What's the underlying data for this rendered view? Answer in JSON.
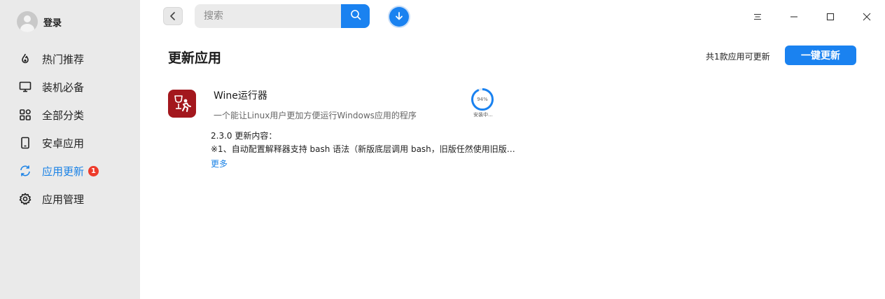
{
  "sidebar": {
    "login_label": "登录",
    "items": [
      {
        "label": "热门推荐",
        "icon": "flame-icon"
      },
      {
        "label": "装机必备",
        "icon": "monitor-icon"
      },
      {
        "label": "全部分类",
        "icon": "grid-icon"
      },
      {
        "label": "安卓应用",
        "icon": "phone-icon"
      },
      {
        "label": "应用更新",
        "icon": "refresh-icon",
        "active": true,
        "badge": "1"
      },
      {
        "label": "应用管理",
        "icon": "gear-icon"
      }
    ]
  },
  "search": {
    "placeholder": "搜索"
  },
  "main": {
    "title": "更新应用",
    "summary": "共1款应用可更新",
    "update_all_label": "一键更新",
    "apps": [
      {
        "name": "Wine运行器",
        "description": "一个能让Linux用户更加方便运行Windows应用的程序",
        "progress_percent": 94,
        "progress_text": "94%",
        "status": "安装中...",
        "changelog_title": "2.3.0 更新内容：",
        "changelog_line": "※1、自动配置解释器支持 bash 语法（新版底层调用 bash，旧版任然使用旧版…",
        "more_label": "更多"
      }
    ]
  },
  "colors": {
    "accent": "#1a82f0",
    "badge": "#ee3b2b",
    "app_icon_bg": "#a3171d"
  }
}
